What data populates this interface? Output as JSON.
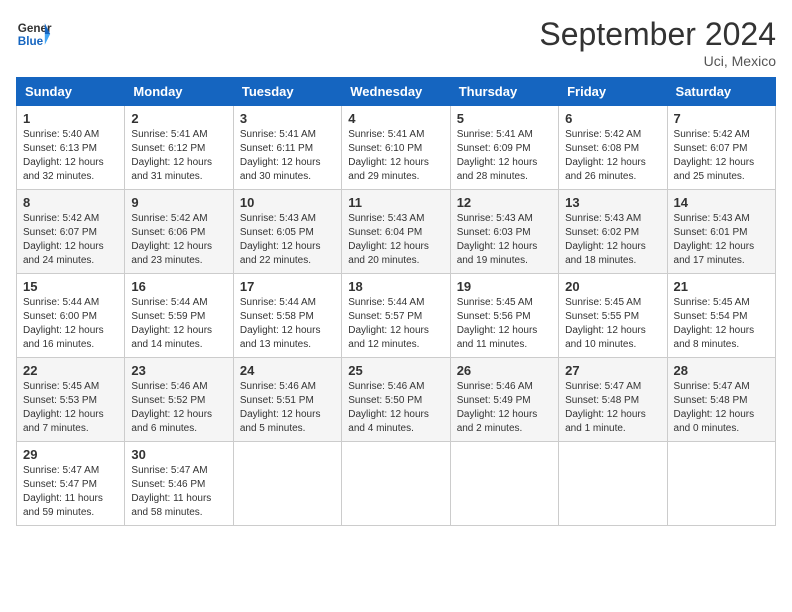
{
  "header": {
    "logo_line1": "General",
    "logo_line2": "Blue",
    "month": "September 2024",
    "location": "Uci, Mexico"
  },
  "weekdays": [
    "Sunday",
    "Monday",
    "Tuesday",
    "Wednesday",
    "Thursday",
    "Friday",
    "Saturday"
  ],
  "weeks": [
    [
      {
        "day": "1",
        "info": "Sunrise: 5:40 AM\nSunset: 6:13 PM\nDaylight: 12 hours\nand 32 minutes."
      },
      {
        "day": "2",
        "info": "Sunrise: 5:41 AM\nSunset: 6:12 PM\nDaylight: 12 hours\nand 31 minutes."
      },
      {
        "day": "3",
        "info": "Sunrise: 5:41 AM\nSunset: 6:11 PM\nDaylight: 12 hours\nand 30 minutes."
      },
      {
        "day": "4",
        "info": "Sunrise: 5:41 AM\nSunset: 6:10 PM\nDaylight: 12 hours\nand 29 minutes."
      },
      {
        "day": "5",
        "info": "Sunrise: 5:41 AM\nSunset: 6:09 PM\nDaylight: 12 hours\nand 28 minutes."
      },
      {
        "day": "6",
        "info": "Sunrise: 5:42 AM\nSunset: 6:08 PM\nDaylight: 12 hours\nand 26 minutes."
      },
      {
        "day": "7",
        "info": "Sunrise: 5:42 AM\nSunset: 6:07 PM\nDaylight: 12 hours\nand 25 minutes."
      }
    ],
    [
      {
        "day": "8",
        "info": "Sunrise: 5:42 AM\nSunset: 6:07 PM\nDaylight: 12 hours\nand 24 minutes."
      },
      {
        "day": "9",
        "info": "Sunrise: 5:42 AM\nSunset: 6:06 PM\nDaylight: 12 hours\nand 23 minutes."
      },
      {
        "day": "10",
        "info": "Sunrise: 5:43 AM\nSunset: 6:05 PM\nDaylight: 12 hours\nand 22 minutes."
      },
      {
        "day": "11",
        "info": "Sunrise: 5:43 AM\nSunset: 6:04 PM\nDaylight: 12 hours\nand 20 minutes."
      },
      {
        "day": "12",
        "info": "Sunrise: 5:43 AM\nSunset: 6:03 PM\nDaylight: 12 hours\nand 19 minutes."
      },
      {
        "day": "13",
        "info": "Sunrise: 5:43 AM\nSunset: 6:02 PM\nDaylight: 12 hours\nand 18 minutes."
      },
      {
        "day": "14",
        "info": "Sunrise: 5:43 AM\nSunset: 6:01 PM\nDaylight: 12 hours\nand 17 minutes."
      }
    ],
    [
      {
        "day": "15",
        "info": "Sunrise: 5:44 AM\nSunset: 6:00 PM\nDaylight: 12 hours\nand 16 minutes."
      },
      {
        "day": "16",
        "info": "Sunrise: 5:44 AM\nSunset: 5:59 PM\nDaylight: 12 hours\nand 14 minutes."
      },
      {
        "day": "17",
        "info": "Sunrise: 5:44 AM\nSunset: 5:58 PM\nDaylight: 12 hours\nand 13 minutes."
      },
      {
        "day": "18",
        "info": "Sunrise: 5:44 AM\nSunset: 5:57 PM\nDaylight: 12 hours\nand 12 minutes."
      },
      {
        "day": "19",
        "info": "Sunrise: 5:45 AM\nSunset: 5:56 PM\nDaylight: 12 hours\nand 11 minutes."
      },
      {
        "day": "20",
        "info": "Sunrise: 5:45 AM\nSunset: 5:55 PM\nDaylight: 12 hours\nand 10 minutes."
      },
      {
        "day": "21",
        "info": "Sunrise: 5:45 AM\nSunset: 5:54 PM\nDaylight: 12 hours\nand 8 minutes."
      }
    ],
    [
      {
        "day": "22",
        "info": "Sunrise: 5:45 AM\nSunset: 5:53 PM\nDaylight: 12 hours\nand 7 minutes."
      },
      {
        "day": "23",
        "info": "Sunrise: 5:46 AM\nSunset: 5:52 PM\nDaylight: 12 hours\nand 6 minutes."
      },
      {
        "day": "24",
        "info": "Sunrise: 5:46 AM\nSunset: 5:51 PM\nDaylight: 12 hours\nand 5 minutes."
      },
      {
        "day": "25",
        "info": "Sunrise: 5:46 AM\nSunset: 5:50 PM\nDaylight: 12 hours\nand 4 minutes."
      },
      {
        "day": "26",
        "info": "Sunrise: 5:46 AM\nSunset: 5:49 PM\nDaylight: 12 hours\nand 2 minutes."
      },
      {
        "day": "27",
        "info": "Sunrise: 5:47 AM\nSunset: 5:48 PM\nDaylight: 12 hours\nand 1 minute."
      },
      {
        "day": "28",
        "info": "Sunrise: 5:47 AM\nSunset: 5:48 PM\nDaylight: 12 hours\nand 0 minutes."
      }
    ],
    [
      {
        "day": "29",
        "info": "Sunrise: 5:47 AM\nSunset: 5:47 PM\nDaylight: 11 hours\nand 59 minutes."
      },
      {
        "day": "30",
        "info": "Sunrise: 5:47 AM\nSunset: 5:46 PM\nDaylight: 11 hours\nand 58 minutes."
      },
      {
        "day": "",
        "info": ""
      },
      {
        "day": "",
        "info": ""
      },
      {
        "day": "",
        "info": ""
      },
      {
        "day": "",
        "info": ""
      },
      {
        "day": "",
        "info": ""
      }
    ]
  ]
}
